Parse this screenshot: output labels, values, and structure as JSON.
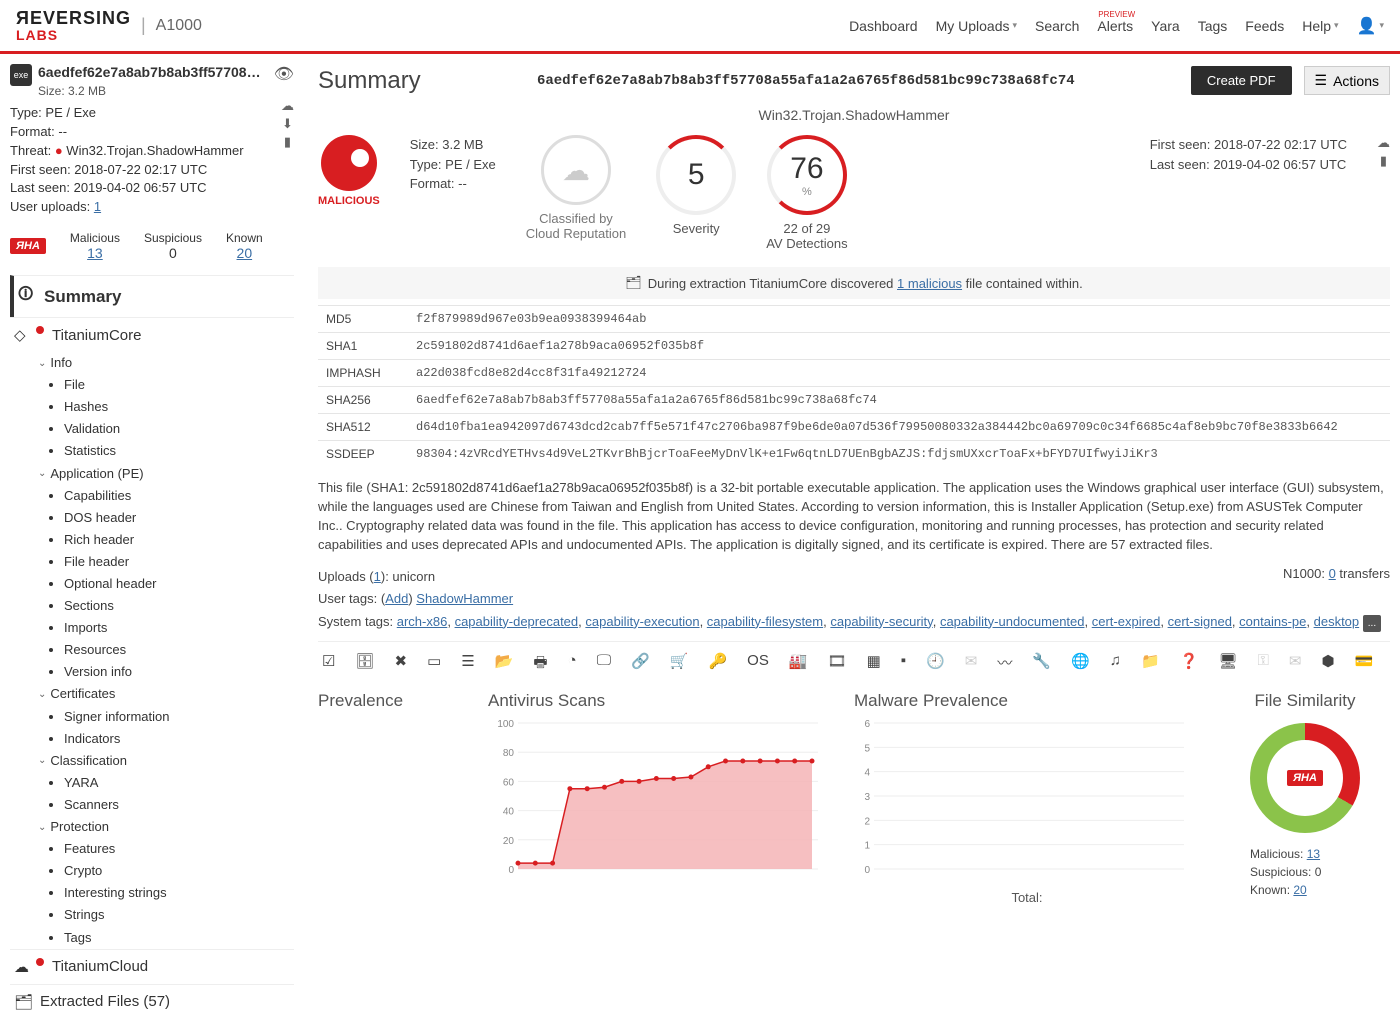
{
  "header": {
    "brand_top": "ЯEVERSING",
    "brand_bottom": "LABS",
    "app_title": "A1000",
    "nav": {
      "dashboard": "Dashboard",
      "my_uploads": "My Uploads",
      "search": "Search",
      "alerts": "Alerts",
      "alerts_badge": "PREVIEW",
      "yara": "Yara",
      "tags": "Tags",
      "feeds": "Feeds",
      "help": "Help"
    }
  },
  "sidebar": {
    "file_name": "6aedfef62e7a8ab7b8ab3ff57708a55afa1...",
    "size": "Size: 3.2 MB",
    "type": "Type: PE / Exe",
    "format": "Format: --",
    "threat_label": "Threat:",
    "threat_value": "Win32.Trojan.ShadowHammer",
    "first_seen": "First seen: 2018-07-22 02:17 UTC",
    "last_seen": "Last seen: 2019-04-02 06:57 UTC",
    "user_uploads_label": "User uploads:",
    "user_uploads_count": "1",
    "counts": {
      "rha": "ЯHA",
      "malicious_label": "Malicious",
      "malicious_value": "13",
      "suspicious_label": "Suspicious",
      "suspicious_value": "0",
      "known_label": "Known",
      "known_value": "20"
    },
    "sections": {
      "summary": "Summary",
      "titaniumcore": "TitaniumCore",
      "titaniumcloud": "TitaniumCloud",
      "extracted": "Extracted Files (57)"
    },
    "tree": {
      "info": "Info",
      "info_items": [
        "File",
        "Hashes",
        "Validation",
        "Statistics"
      ],
      "app": "Application (PE)",
      "app_items": [
        "Capabilities",
        "DOS header",
        "Rich header",
        "File header",
        "Optional header",
        "Sections",
        "Imports",
        "Resources",
        "Version info"
      ],
      "cert": "Certificates",
      "cert_items": [
        "Signer information"
      ],
      "indicators": "Indicators",
      "classif": "Classification",
      "classif_items": [
        "YARA",
        "Scanners"
      ],
      "prot": "Protection",
      "prot_items": [
        "Features",
        "Crypto"
      ],
      "interesting": "Interesting strings",
      "strings": "Strings",
      "tags": "Tags"
    }
  },
  "main": {
    "title": "Summary",
    "hash": "6aedfef62e7a8ab7b8ab3ff57708a55afa1a2a6765f86d581bc99c738a68fc74",
    "create_pdf": "Create PDF",
    "actions": "Actions",
    "threat_name": "Win32.Trojan.ShadowHammer",
    "malicious_label": "MALICIOUS",
    "kv": {
      "size": "Size: 3.2 MB",
      "type": "Type: PE / Exe",
      "format": "Format: --"
    },
    "class_by": "Classified by",
    "class_src": "Cloud Reputation",
    "severity_value": "5",
    "severity_label": "Severity",
    "av_value": "76",
    "av_pct": "%",
    "av_sub": "22 of 29",
    "av_label": "AV Detections",
    "first_seen": "First seen: 2018-07-22 02:17 UTC",
    "last_seen": "Last seen: 2019-04-02 06:57 UTC",
    "notice_pre": "During extraction TitaniumCore discovered ",
    "notice_link": "1 malicious",
    "notice_post": " file contained within.",
    "hashes": {
      "md5_l": "MD5",
      "md5": "f2f879989d967e03b9ea0938399464ab",
      "sha1_l": "SHA1",
      "sha1": "2c591802d8741d6aef1a278b9aca06952f035b8f",
      "imp_l": "IMPHASH",
      "imp": "a22d038fcd8e82d4cc8f31fa49212724",
      "sha256_l": "SHA256",
      "sha256": "6aedfef62e7a8ab7b8ab3ff57708a55afa1a2a6765f86d581bc99c738a68fc74",
      "sha512_l": "SHA512",
      "sha512": "d64d10fba1ea942097d6743dcd2cab7ff5e571f47c2706ba987f9be6de0a07d536f79950080332a384442bc0a69709c0c34f6685c4af8eb9bc70f8e3833b6642",
      "ssdeep_l": "SSDEEP",
      "ssdeep": "98304:4zVRcdYETHvs4d9VeL2TKvrBhBjcrToaFeeMyDnVlK+e1Fw6qtnLD7UEnBgbAZJS:fdjsmUXxcrToaFx+bFYD7UIfwyiJiKr3"
    },
    "description": "This file (SHA1: 2c591802d8741d6aef1a278b9aca06952f035b8f) is a 32-bit portable executable application. The application uses the Windows graphical user interface (GUI) subsystem, while the languages used are Chinese from Taiwan and English from United States. According to version information, this is Installer Application (Setup.exe) from ASUSTek Computer Inc.. Cryptography related data was found in the file. This application has access to device configuration, monitoring and running processes, has protection and security related capabilities and uses deprecated APIs and undocumented APIs. The application is digitally signed, and its certificate is expired. There are 57 extracted files.",
    "uploads_pre": "Uploads (",
    "uploads_n": "1",
    "uploads_post": "): unicorn",
    "user_tags_pre": "User tags: (",
    "user_tags_add": "Add",
    "user_tags_post": ") ",
    "user_tag_link": "ShadowHammer",
    "sys_tags_label": "System tags: ",
    "sys_tags": [
      "arch-x86",
      "capability-deprecated",
      "capability-execution",
      "capability-filesystem",
      "capability-security",
      "capability-undocumented",
      "cert-expired",
      "cert-signed",
      "contains-pe",
      "desktop"
    ],
    "more": "...",
    "transfers_pre": "N1000: ",
    "transfers_n": "0",
    "transfers_post": " transfers",
    "ch_prev": "Prevalence",
    "ch_av": "Antivirus Scans",
    "ch_mal": "Malware Prevalence",
    "ch_sim": "File Similarity",
    "total": "Total:",
    "sim": {
      "mal_l": "Malicious:",
      "mal_v": "13",
      "sus_l": "Suspicious:",
      "sus_v": "0",
      "kn_l": "Known:",
      "kn_v": "20"
    }
  },
  "chart_data": [
    {
      "type": "area",
      "title": "Antivirus Scans",
      "ylim": [
        0,
        100
      ],
      "yticks": [
        0,
        20,
        40,
        60,
        80,
        100
      ],
      "x": [
        0,
        1,
        2,
        3,
        4,
        5,
        6,
        7,
        8,
        9,
        10,
        11,
        12,
        13,
        14,
        15,
        16,
        17
      ],
      "values": [
        4,
        4,
        4,
        55,
        55,
        56,
        60,
        60,
        62,
        62,
        63,
        70,
        74,
        74,
        74,
        74,
        74,
        74
      ]
    },
    {
      "type": "line",
      "title": "Malware Prevalence",
      "ylim": [
        0,
        6
      ],
      "yticks": [
        0,
        1,
        2,
        3,
        4,
        5,
        6
      ],
      "x": [],
      "values": []
    },
    {
      "type": "pie",
      "title": "File Similarity",
      "series": [
        {
          "name": "Malicious",
          "value": 13
        },
        {
          "name": "Suspicious",
          "value": 0
        },
        {
          "name": "Known",
          "value": 20
        }
      ]
    }
  ]
}
